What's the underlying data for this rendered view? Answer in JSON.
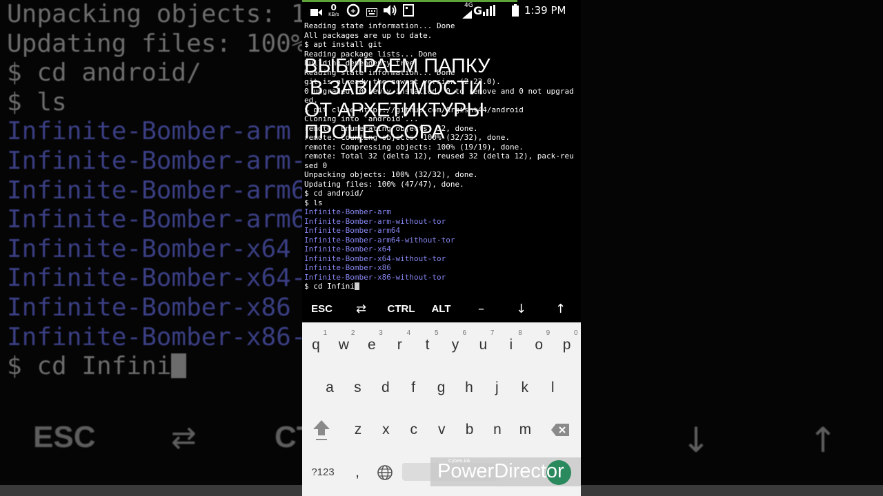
{
  "status_bar": {
    "speed_value": "0",
    "speed_unit": "KB/s",
    "network": "4G",
    "carrier_letter": "G",
    "time": "1:39 PM"
  },
  "terminal": {
    "lines": [
      {
        "text": "Reading state information... Done",
        "type": "plain"
      },
      {
        "text": "All packages are up to date.",
        "type": "plain"
      },
      {
        "text": "$ apt install git",
        "type": "plain"
      },
      {
        "text": "Reading package lists... Done",
        "type": "plain"
      },
      {
        "text": "Building dependency tree",
        "type": "plain"
      },
      {
        "text": "Reading state information... Done",
        "type": "plain"
      },
      {
        "text": "git is already the newest version (2.23.0).",
        "type": "plain"
      },
      {
        "text": "0 upgraded, 0 newly installed, 0 to remove and 0 not upgrad",
        "type": "plain"
      },
      {
        "text": "ed.",
        "type": "plain"
      },
      {
        "text": "$ git clone https://github.com/Argisht44/android",
        "type": "plain"
      },
      {
        "text": "Cloning into 'android'...",
        "type": "plain"
      },
      {
        "text": "remote: Enumerating objects: 32, done.",
        "type": "plain"
      },
      {
        "text": "remote: Counting objects: 100% (32/32), done.",
        "type": "plain"
      },
      {
        "text": "remote: Compressing objects: 100% (19/19), done.",
        "type": "plain"
      },
      {
        "text": "remote: Total 32 (delta 12), reused 32 (delta 12), pack-reu",
        "type": "plain"
      },
      {
        "text": "sed 0",
        "type": "plain"
      },
      {
        "text": "Unpacking objects: 100% (32/32), done.",
        "type": "plain"
      },
      {
        "text": "Updating files: 100% (47/47), done.",
        "type": "plain"
      },
      {
        "text": "$ cd android/",
        "type": "plain"
      },
      {
        "text": "$ ls",
        "type": "plain"
      },
      {
        "text": "Infinite-Bomber-arm",
        "type": "file"
      },
      {
        "text": "Infinite-Bomber-arm-without-tor",
        "type": "file"
      },
      {
        "text": "Infinite-Bomber-arm64",
        "type": "file"
      },
      {
        "text": "Infinite-Bomber-arm64-without-tor",
        "type": "file"
      },
      {
        "text": "Infinite-Bomber-x64",
        "type": "file"
      },
      {
        "text": "Infinite-Bomber-x64-without-tor",
        "type": "file"
      },
      {
        "text": "Infinite-Bomber-x86",
        "type": "file"
      },
      {
        "text": "Infinite-Bomber-x86-without-tor",
        "type": "file"
      }
    ],
    "prompt": "$ cd Infini"
  },
  "overlay_caption": [
    "ВЫБИРАЕМ ПАПКУ",
    " В ЗАВИСИМОСТИ",
    "ОТ АРХЕТИКТУРЫ",
    "ПРОЦЕССОРА"
  ],
  "extra_keys": [
    "ESC",
    "⇄",
    "CTRL",
    "ALT",
    "–",
    "↓",
    "↑"
  ],
  "keyboard": {
    "row1": [
      {
        "key": "q",
        "hint": "1"
      },
      {
        "key": "w",
        "hint": "2"
      },
      {
        "key": "e",
        "hint": "3"
      },
      {
        "key": "r",
        "hint": "4"
      },
      {
        "key": "t",
        "hint": "5"
      },
      {
        "key": "y",
        "hint": "6"
      },
      {
        "key": "u",
        "hint": "7"
      },
      {
        "key": "i",
        "hint": "8"
      },
      {
        "key": "o",
        "hint": "9"
      },
      {
        "key": "p",
        "hint": "0"
      }
    ],
    "row2": [
      "a",
      "s",
      "d",
      "f",
      "g",
      "h",
      "j",
      "k",
      "l"
    ],
    "row3": [
      "z",
      "x",
      "c",
      "v",
      "b",
      "n",
      "m"
    ],
    "symbols_key": "?123",
    "comma_key": ","
  },
  "background": {
    "lines": [
      {
        "text": "Unpacking objects: 1",
        "type": "plain"
      },
      {
        "text": "Updating files: 100%",
        "type": "plain"
      },
      {
        "text": "$ cd android/",
        "type": "plain"
      },
      {
        "text": "$ ls",
        "type": "plain"
      },
      {
        "text": "Infinite-Bomber-arm",
        "type": "file"
      },
      {
        "text": "Infinite-Bomber-arm-",
        "type": "file"
      },
      {
        "text": "Infinite-Bomber-arm6",
        "type": "file"
      },
      {
        "text": "Infinite-Bomber-arm6",
        "type": "file"
      },
      {
        "text": "Infinite-Bomber-x64",
        "type": "file"
      },
      {
        "text": "Infinite-Bomber-x64-",
        "type": "file"
      },
      {
        "text": "Infinite-Bomber-x86",
        "type": "file"
      },
      {
        "text": "Infinite-Bomber-x86-",
        "type": "file"
      }
    ],
    "prompt": "$ cd Infini",
    "keys_left": [
      "ESC",
      "⇄",
      "CT"
    ],
    "keys_right": [
      "↓",
      "↑"
    ]
  },
  "watermark": {
    "small": "CyberLink",
    "text": "PowerDirector"
  }
}
